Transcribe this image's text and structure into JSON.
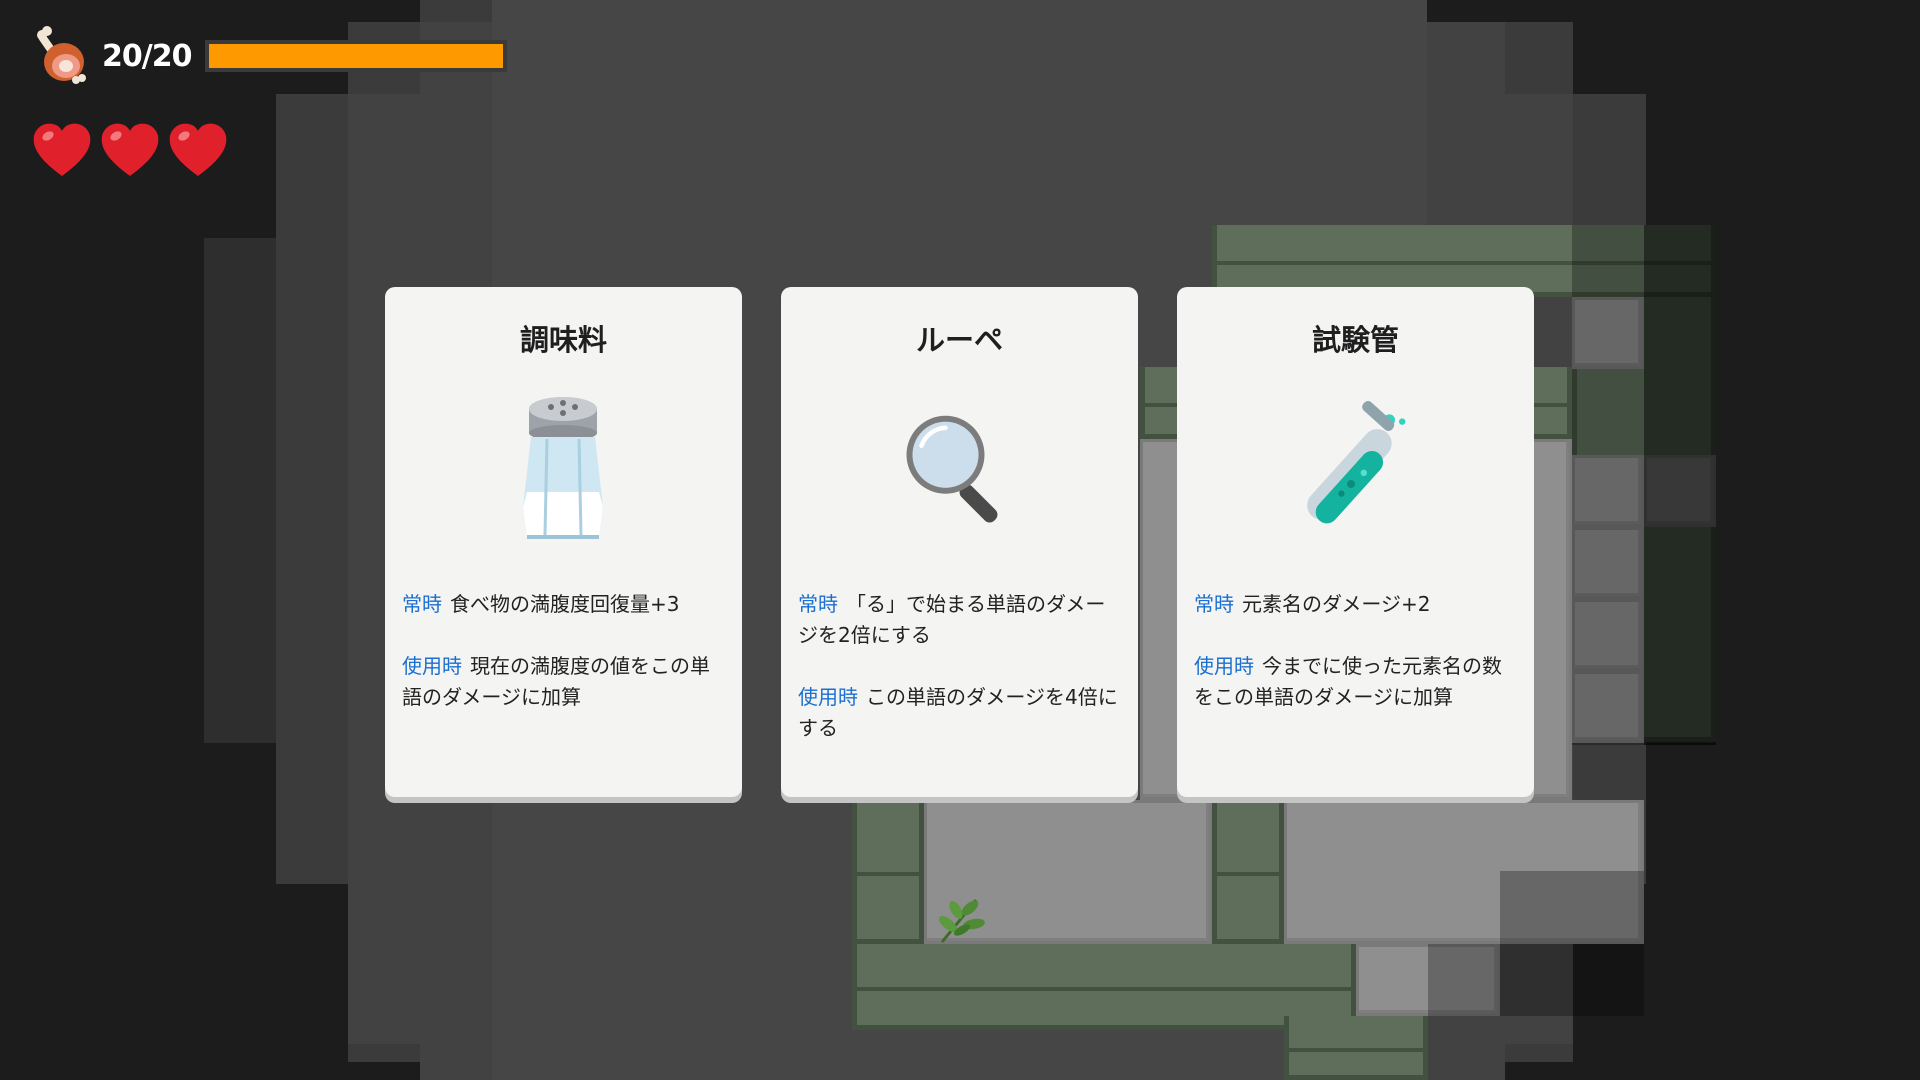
{
  "hud": {
    "food": {
      "value_text": "20/20",
      "current": 20,
      "max": 20,
      "icon": "meat-icon",
      "bar_color": "#ff9900"
    },
    "hearts": [
      {
        "icon": "heart-icon",
        "color": "#e0202a"
      },
      {
        "icon": "heart-icon",
        "color": "#e0202a"
      },
      {
        "icon": "heart-icon",
        "color": "#e0202a"
      }
    ]
  },
  "cards": [
    {
      "title": "調味料",
      "icon": "salt-shaker-icon",
      "effects": [
        {
          "tag": "常時",
          "text": "食べ物の満腹度回復量+3"
        },
        {
          "tag": "使用時",
          "text": "現在の満腹度の値をこの単語のダメージに加算"
        }
      ]
    },
    {
      "title": "ルーペ",
      "icon": "magnifying-glass-icon",
      "effects": [
        {
          "tag": "常時",
          "text": "「る」で始まる単語のダメージを2倍にする"
        },
        {
          "tag": "使用時",
          "text": "この単語のダメージを4倍にする"
        }
      ]
    },
    {
      "title": "試験管",
      "icon": "test-tube-icon",
      "effects": [
        {
          "tag": "常時",
          "text": "元素名のダメージ+2"
        },
        {
          "tag": "使用時",
          "text": "今までに使った元素名の数をこの単語のダメージに加算"
        }
      ]
    }
  ],
  "map": {
    "item_icon": "herb-icon"
  },
  "colors": {
    "tag_blue": "#1b6fd1",
    "card_bg": "#f4f4f2",
    "wall_green": "#5e6e5b",
    "floor_gray": "#8f8f8f"
  }
}
